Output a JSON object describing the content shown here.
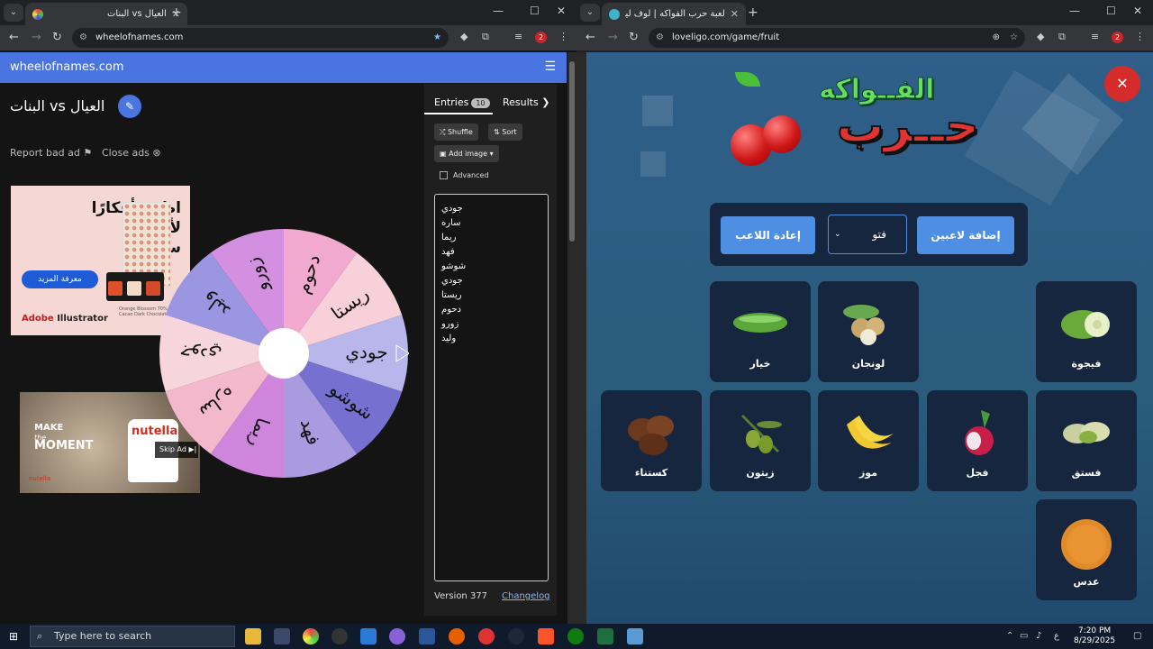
{
  "left_browser": {
    "tab_title": "العيال vs البنات",
    "url": "wheelofnames.com",
    "ext_badge": "2",
    "site": {
      "brand": "wheelofnames.com",
      "title": "البنات vs العيال",
      "report_ad": "Report bad ad",
      "close_ads": "Close ads",
      "ad1": {
        "line1": "اطرح أفكارًا",
        "line2": "لأنماط",
        "line3": "سلسة.",
        "button": "معرفة المزيد",
        "brand_a": "Adobe",
        "brand_b": "Illustrator",
        "small": "Orange Blossom 70% Cacao Dark Chocolate"
      },
      "ad2": {
        "make": "MAKE",
        "the": "the",
        "moment": "MOMENT",
        "product": "nutella",
        "skip": "Skip Ad ▶|",
        "logo": "nutella"
      },
      "tabs": {
        "entries": "Entries",
        "entries_count": "10",
        "results": "Results"
      },
      "buttons": {
        "shuffle": "Shuffle",
        "sort": "Sort",
        "add_image": "Add image",
        "advanced": "Advanced"
      },
      "entries": [
        "جودي",
        "ساره",
        "ريما",
        "فهد",
        "شوشو",
        "جودي",
        "ريستا",
        "دحوم",
        "زورو",
        "وليد"
      ],
      "version": "Version 377",
      "changelog": "Changelog"
    },
    "wheel": {
      "segments": [
        "جودي",
        "شوشو",
        "فهد",
        "ريما",
        "ساره",
        "جودي",
        "وليد",
        "زورو",
        "دحوم",
        "ريستا"
      ],
      "colors": [
        "#b8b6ea",
        "#7670d0",
        "#a89be0",
        "#d085dc",
        "#f4b8cc",
        "#f6d6dc",
        "#9b96e2",
        "#d38fe0",
        "#f2a9d0",
        "#f7d0da"
      ]
    }
  },
  "right_browser": {
    "tab_title": "لعبة حرب الفواكه | لوف ليجو يوم",
    "url": "loveligo.com/game/fruit",
    "ext_badge": "2",
    "game": {
      "logo_top": "الفــواكه",
      "logo_main": "حــرب",
      "add_players": "إضافة لاعبين",
      "player_select": "فتو",
      "reset_player": "إعادة اللاعب",
      "close": "✕",
      "cards": [
        {
          "name": "خيار",
          "icon": "cucumber-icon"
        },
        {
          "name": "لونجان",
          "icon": "longan-icon"
        },
        {
          "name": "فيجوة",
          "icon": "feijoa-icon"
        },
        {
          "name": "كستناء",
          "icon": "chestnut-icon"
        },
        {
          "name": "زيتون",
          "icon": "olive-icon"
        },
        {
          "name": "موز",
          "icon": "banana-icon"
        },
        {
          "name": "فجل",
          "icon": "radish-icon"
        },
        {
          "name": "فستق",
          "icon": "pistachio-icon"
        },
        {
          "name": "عدس",
          "icon": "lentil-icon"
        }
      ]
    }
  },
  "taskbar": {
    "search_placeholder": "Type here to search",
    "lang": "ع",
    "time": "7:20 PM",
    "date": "8/29/2025"
  }
}
